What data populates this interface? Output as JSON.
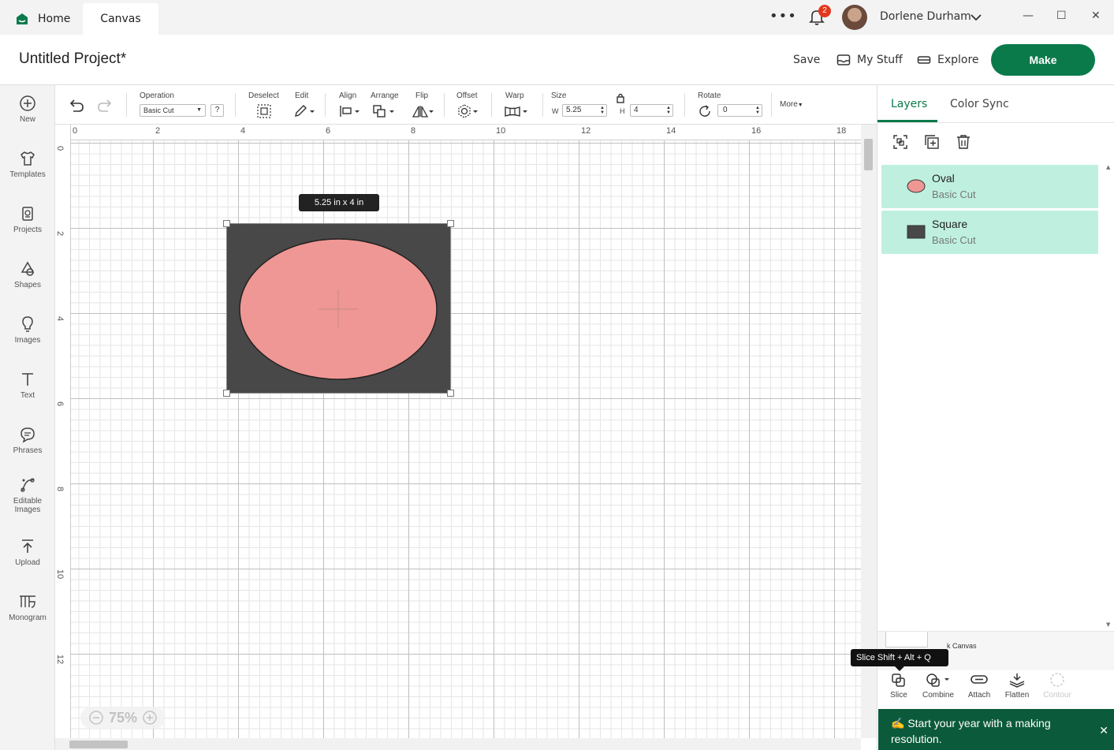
{
  "titlebar": {
    "tabs": [
      {
        "label": "Home"
      },
      {
        "label": "Canvas"
      }
    ],
    "more": "•••",
    "notification_count": "2",
    "user_name": "Dorlene Durham",
    "window_buttons": {
      "minimize": "—",
      "maximize": "☐",
      "close": "✕"
    }
  },
  "header": {
    "project_title": "Untitled Project*",
    "save": "Save",
    "my_stuff": "My Stuff",
    "explore": "Explore",
    "make": "Make",
    "brand_color": "#0b7a4b"
  },
  "sidebar": {
    "items": [
      {
        "label": "New",
        "icon": "plus-circle-icon"
      },
      {
        "label": "Templates",
        "icon": "shirt-icon"
      },
      {
        "label": "Projects",
        "icon": "projects-icon"
      },
      {
        "label": "Shapes",
        "icon": "shapes-icon"
      },
      {
        "label": "Images",
        "icon": "lightbulb-icon"
      },
      {
        "label": "Text",
        "icon": "text-icon"
      },
      {
        "label": "Phrases",
        "icon": "speech-bubble-icon"
      },
      {
        "label": "Editable Images",
        "icon": "editable-images-icon"
      },
      {
        "label": "Upload",
        "icon": "upload-icon"
      },
      {
        "label": "Monogram",
        "icon": "monogram-icon"
      }
    ]
  },
  "toolbar": {
    "operation_label": "Operation",
    "operation_value": "Basic Cut",
    "operation_help": "?",
    "deselect": "Deselect",
    "edit": "Edit",
    "align": "Align",
    "arrange": "Arrange",
    "flip": "Flip",
    "offset": "Offset",
    "warp": "Warp",
    "size_label": "Size",
    "w_label": "W",
    "w_value": "5.25",
    "h_label": "H",
    "h_value": "4",
    "rotate_label": "Rotate",
    "rotate_value": "0",
    "more": "More"
  },
  "canvas": {
    "ruler_top": [
      "0",
      "2",
      "4",
      "6",
      "8",
      "10",
      "12",
      "14",
      "16",
      "18"
    ],
    "ruler_left": [
      "0",
      "2",
      "4",
      "6",
      "8",
      "10",
      "12"
    ],
    "size_tooltip": "5.25  in x 4  in",
    "zoom": "75%",
    "square_color": "#484848",
    "oval_color": "#ef9794"
  },
  "panel": {
    "tabs": [
      {
        "label": "Layers"
      },
      {
        "label": "Color Sync"
      }
    ],
    "layers": [
      {
        "name": "Oval",
        "operation": "Basic Cut",
        "swatch": "#ef9794"
      },
      {
        "name": "Square",
        "operation": "Basic Cut",
        "swatch": "#484848"
      }
    ],
    "blank_canvas_label": "k Canvas",
    "tooltip": "Slice  Shift + Alt + Q",
    "bottom_tools": [
      {
        "label": "Slice"
      },
      {
        "label": "Combine"
      },
      {
        "label": "Attach"
      },
      {
        "label": "Flatten"
      },
      {
        "label": "Contour"
      }
    ],
    "banner_text": "Start your year with a making resolution.",
    "banner_close": "✕"
  }
}
